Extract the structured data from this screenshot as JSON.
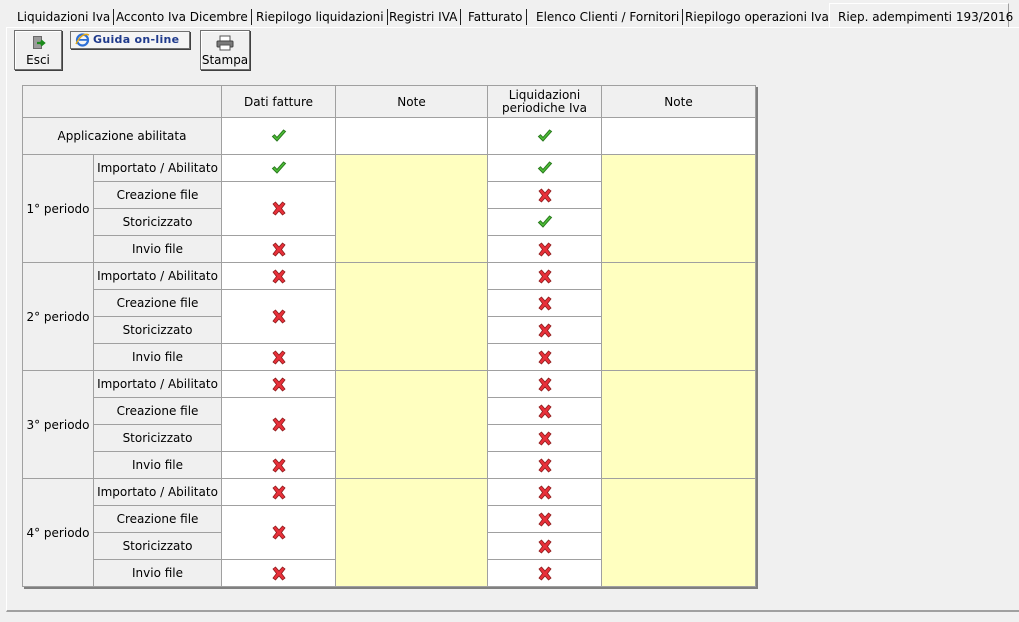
{
  "tabs": [
    {
      "label": "Liquidazioni Iva",
      "active": false
    },
    {
      "label": "Acconto Iva Dicembre",
      "active": false
    },
    {
      "label": "Riepilogo liquidazioni",
      "active": false
    },
    {
      "label": "Registri IVA",
      "active": false
    },
    {
      "label": "Fatturato",
      "active": false
    },
    {
      "label": "Elenco Clienti / Fornitori",
      "active": false
    },
    {
      "label": "Riepilogo operazioni Iva",
      "active": false
    },
    {
      "label": "Riep. adempimenti 193/2016",
      "active": true
    }
  ],
  "toolbar": {
    "esci_label": "Esci",
    "guida_label": "Guida on-line",
    "stampa_label": "Stampa"
  },
  "table": {
    "headers": {
      "corner": "",
      "dati_fatture": "Dati fatture",
      "note1": "Note",
      "liquidazioni": "Liquidazioni periodiche Iva",
      "note2": "Note"
    },
    "app_row": {
      "label": "Applicazione abilitata",
      "dati_fatture": "ok",
      "liquidazioni": "ok"
    },
    "periods": [
      {
        "label": "1° periodo",
        "steps": [
          {
            "label": "Importato / Abilitato",
            "df": "ok",
            "lp": "ok"
          },
          {
            "label": "Creazione file",
            "df": "no",
            "lp": "no"
          },
          {
            "label": "Storicizzato",
            "df": null,
            "lp": "ok"
          },
          {
            "label": "Invio file",
            "df": "no",
            "lp": "no"
          }
        ]
      },
      {
        "label": "2° periodo",
        "steps": [
          {
            "label": "Importato / Abilitato",
            "df": "no",
            "lp": "no"
          },
          {
            "label": "Creazione file",
            "df": "no",
            "lp": "no"
          },
          {
            "label": "Storicizzato",
            "df": null,
            "lp": "no"
          },
          {
            "label": "Invio file",
            "df": "no",
            "lp": "no"
          }
        ]
      },
      {
        "label": "3° periodo",
        "steps": [
          {
            "label": "Importato / Abilitato",
            "df": "no",
            "lp": "no"
          },
          {
            "label": "Creazione file",
            "df": "no",
            "lp": "no"
          },
          {
            "label": "Storicizzato",
            "df": null,
            "lp": "no"
          },
          {
            "label": "Invio file",
            "df": "no",
            "lp": "no"
          }
        ]
      },
      {
        "label": "4° periodo",
        "steps": [
          {
            "label": "Importato / Abilitato",
            "df": "no",
            "lp": "no"
          },
          {
            "label": "Creazione file",
            "df": "no",
            "lp": "no"
          },
          {
            "label": "Storicizzato",
            "df": null,
            "lp": "no"
          },
          {
            "label": "Invio file",
            "df": "no",
            "lp": "no"
          }
        ]
      }
    ]
  },
  "icons": {
    "ok": "green-check-icon",
    "no": "red-x-icon"
  },
  "colors": {
    "note_bg": "#ffffc0",
    "check": "#3fae2a",
    "cross": "#e0202c"
  }
}
